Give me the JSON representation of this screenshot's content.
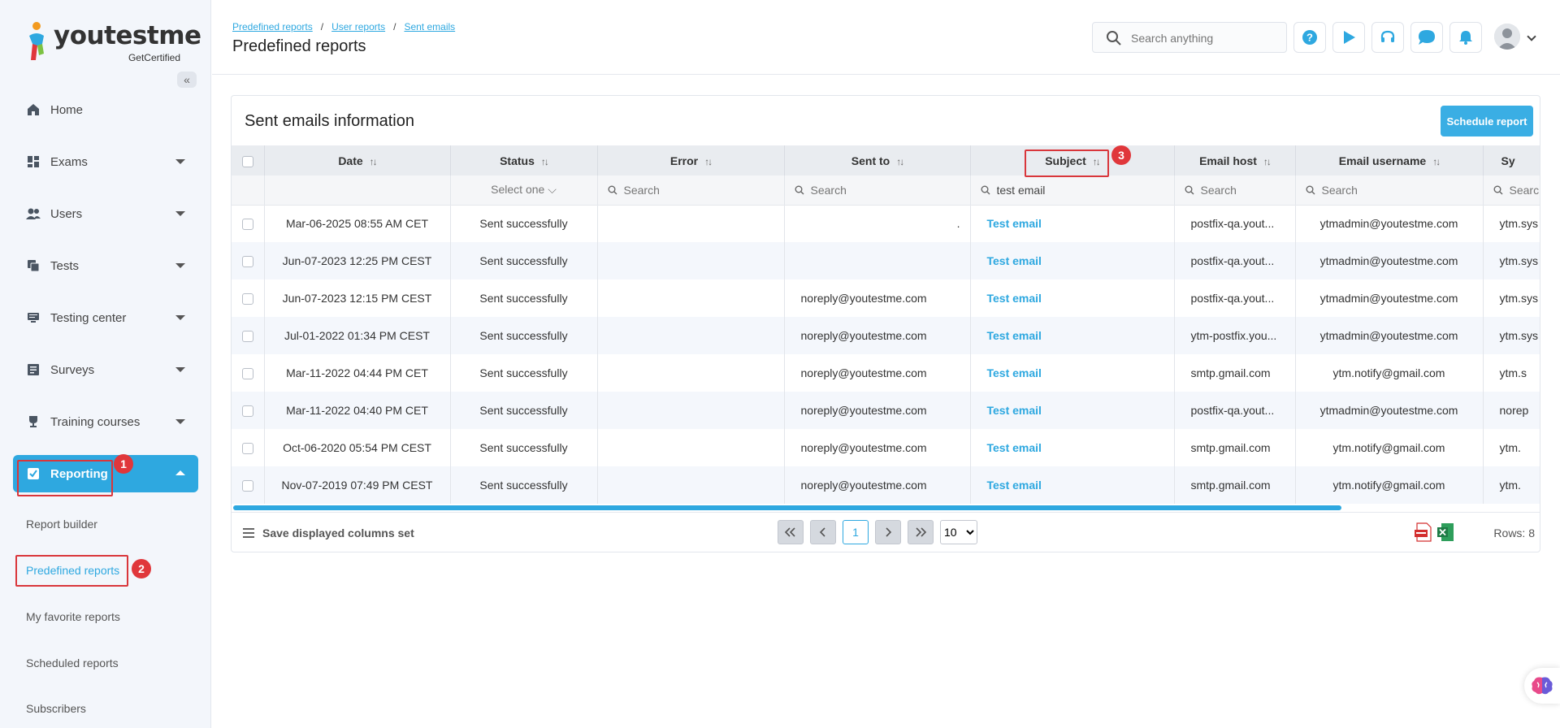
{
  "brand": {
    "name_part1": "youtest",
    "name_part2": "me",
    "tagline": "GetCertified"
  },
  "sidebar": {
    "collapse_label": "«",
    "items": [
      {
        "label": "Home",
        "icon": "home-icon",
        "expandable": false
      },
      {
        "label": "Exams",
        "icon": "exams-icon",
        "expandable": true
      },
      {
        "label": "Users",
        "icon": "users-icon",
        "expandable": true
      },
      {
        "label": "Tests",
        "icon": "tests-icon",
        "expandable": true
      },
      {
        "label": "Testing center",
        "icon": "testing-center-icon",
        "expandable": true
      },
      {
        "label": "Surveys",
        "icon": "surveys-icon",
        "expandable": true
      },
      {
        "label": "Training courses",
        "icon": "trophy-icon",
        "expandable": true
      },
      {
        "label": "Reporting",
        "icon": "reporting-icon",
        "expandable": true,
        "active": true
      }
    ],
    "subitems": [
      "Report builder",
      "Predefined reports",
      "My favorite reports",
      "Scheduled reports",
      "Subscribers"
    ],
    "current_subitem": "Predefined reports"
  },
  "markers": [
    "1",
    "2",
    "3"
  ],
  "header": {
    "breadcrumb": [
      "Predefined reports",
      "User reports",
      "Sent emails"
    ],
    "breadcrumb_sep": "/",
    "title": "Predefined reports",
    "search_placeholder": "Search anything"
  },
  "card": {
    "title": "Sent emails information",
    "schedule_label": "Schedule report",
    "sort_glyph": "↑↓",
    "columns": [
      "Date",
      "Status",
      "Error",
      "Sent to",
      "Subject",
      "Email host",
      "Email username",
      "Sy"
    ],
    "filters": {
      "status": "Select one",
      "error": "",
      "sent_to": "",
      "subject": "test email",
      "email_host": "",
      "email_username": "",
      "last": "",
      "search_placeholder": "Search",
      "last_placeholder": "Searc"
    },
    "rows": [
      {
        "date": "Mar-06-2025 08:55 AM CET",
        "status": "Sent successfully",
        "error": "",
        "sent_to": ".",
        "subject": "Test email",
        "host": "postfix-qa.yout...",
        "username": "ytmadmin@youtestme.com",
        "last": "ytm.sys"
      },
      {
        "date": "Jun-07-2023 12:25 PM CEST",
        "status": "Sent successfully",
        "error": "",
        "sent_to": "",
        "subject": "Test email",
        "host": "postfix-qa.yout...",
        "username": "ytmadmin@youtestme.com",
        "last": "ytm.sys"
      },
      {
        "date": "Jun-07-2023 12:15 PM CEST",
        "status": "Sent successfully",
        "error": "",
        "sent_to": "noreply@youtestme.com",
        "subject": "Test email",
        "host": "postfix-qa.yout...",
        "username": "ytmadmin@youtestme.com",
        "last": "ytm.sys"
      },
      {
        "date": "Jul-01-2022 01:34 PM CEST",
        "status": "Sent successfully",
        "error": "",
        "sent_to": "noreply@youtestme.com",
        "subject": "Test email",
        "host": "ytm-postfix.you...",
        "username": "ytmadmin@youtestme.com",
        "last": "ytm.sys"
      },
      {
        "date": "Mar-11-2022 04:44 PM CET",
        "status": "Sent successfully",
        "error": "",
        "sent_to": "noreply@youtestme.com",
        "subject": "Test email",
        "host": "smtp.gmail.com",
        "username": "ytm.notify@gmail.com",
        "last": "ytm.s"
      },
      {
        "date": "Mar-11-2022 04:40 PM CET",
        "status": "Sent successfully",
        "error": "",
        "sent_to": "noreply@youtestme.com",
        "subject": "Test email",
        "host": "postfix-qa.yout...",
        "username": "ytmadmin@youtestme.com",
        "last": "norep"
      },
      {
        "date": "Oct-06-2020 05:54 PM CEST",
        "status": "Sent successfully",
        "error": "",
        "sent_to": "noreply@youtestme.com",
        "subject": "Test email",
        "host": "smtp.gmail.com",
        "username": "ytm.notify@gmail.com",
        "last": "ytm."
      },
      {
        "date": "Nov-07-2019 07:49 PM CEST",
        "status": "Sent successfully",
        "error": "",
        "sent_to": "noreply@youtestme.com",
        "subject": "Test email",
        "host": "smtp.gmail.com",
        "username": "ytm.notify@gmail.com",
        "last": "ytm."
      }
    ],
    "footer": {
      "save_columns_label": "Save displayed columns set",
      "current_page": "1",
      "page_size": "10",
      "rows_label": "Rows: 8"
    }
  },
  "colors": {
    "accent": "#2ea8e0",
    "marker": "#e0373b",
    "pdf": "#d32f2f",
    "excel": "#1e7b45"
  }
}
